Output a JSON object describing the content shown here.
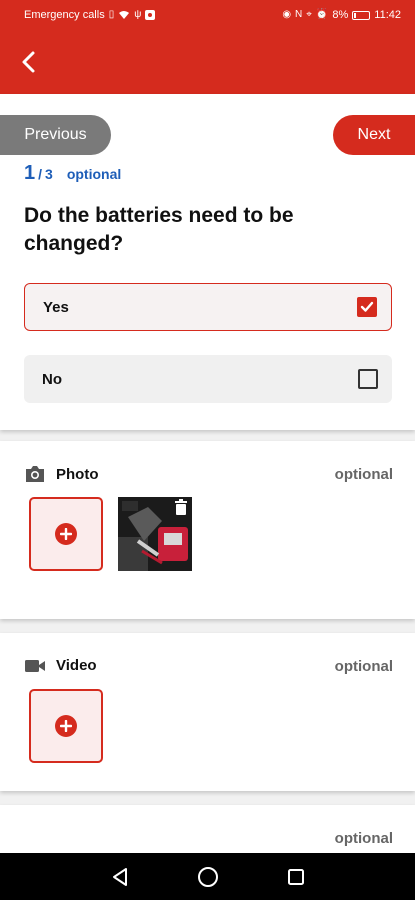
{
  "status_bar": {
    "carrier": "Emergency calls",
    "battery": "8%",
    "time": "11:42"
  },
  "nav": {
    "previous_label": "Previous",
    "next_label": "Next"
  },
  "question": {
    "current": "1",
    "total": "3",
    "optional_label": "optional",
    "text": "Do the batteries need to be changed?",
    "answers": [
      {
        "label": "Yes",
        "checked": true
      },
      {
        "label": "No",
        "checked": false
      }
    ]
  },
  "photo": {
    "title": "Photo",
    "optional_label": "optional"
  },
  "video": {
    "title": "Video",
    "optional_label": "optional"
  },
  "third_section": {
    "optional_label": "optional"
  },
  "colors": {
    "brand_red": "#d52b1e",
    "progress_blue": "#1e5eb8"
  },
  "icons": [
    "back-arrow-icon",
    "camera-icon",
    "video-camera-icon",
    "plus-circle-icon",
    "trash-icon",
    "checkbox-checked-icon",
    "checkbox-empty-icon",
    "nav-back-icon",
    "nav-home-icon",
    "nav-recents-icon"
  ]
}
